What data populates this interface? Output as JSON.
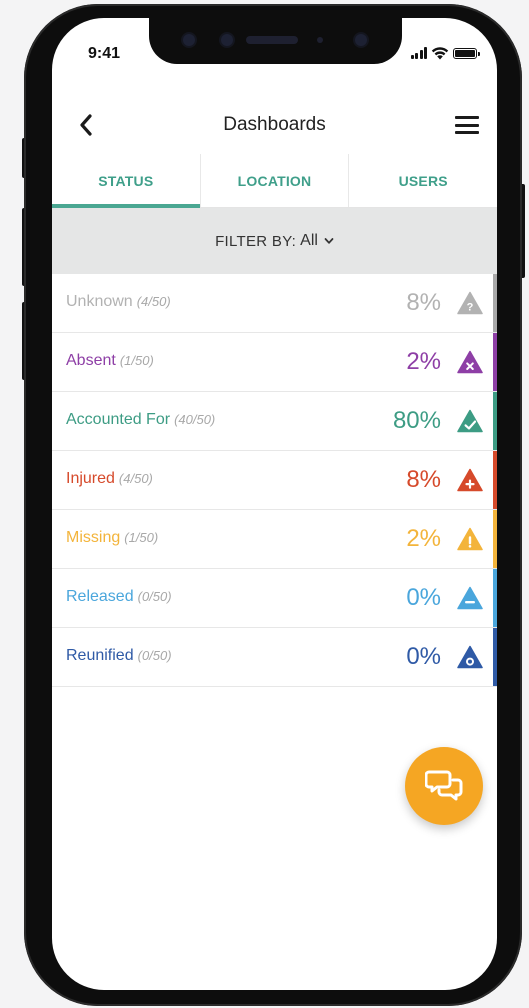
{
  "status_bar": {
    "time": "9:41"
  },
  "header": {
    "title": "Dashboards"
  },
  "tabs": [
    {
      "label": "STATUS",
      "active": true
    },
    {
      "label": "LOCATION",
      "active": false
    },
    {
      "label": "USERS",
      "active": false
    }
  ],
  "filter": {
    "prefix": "FILTER BY:",
    "value": "All"
  },
  "statuses": [
    {
      "label": "Unknown",
      "count": "(4/50)",
      "percent": "8%",
      "color": "#b2b2b2",
      "stripe": "#a9a9a9",
      "icon": "question-triangle-icon"
    },
    {
      "label": "Absent",
      "count": "(1/50)",
      "percent": "2%",
      "color": "#8e3fa6",
      "stripe": "#8e3fa6",
      "icon": "x-triangle-icon"
    },
    {
      "label": "Accounted For",
      "count": "(40/50)",
      "percent": "80%",
      "color": "#3d9c84",
      "stripe": "#3d9c84",
      "icon": "check-triangle-icon"
    },
    {
      "label": "Injured",
      "count": "(4/50)",
      "percent": "8%",
      "color": "#d64a2b",
      "stripe": "#d64a2b",
      "icon": "plus-triangle-icon"
    },
    {
      "label": "Missing",
      "count": "(1/50)",
      "percent": "2%",
      "color": "#f3b43b",
      "stripe": "#f3b43b",
      "icon": "exclamation-triangle-icon"
    },
    {
      "label": "Released",
      "count": "(0/50)",
      "percent": "0%",
      "color": "#4aa6dc",
      "stripe": "#4aa6dc",
      "icon": "minus-triangle-icon"
    },
    {
      "label": "Reunified",
      "count": "(0/50)",
      "percent": "0%",
      "color": "#2f5aa6",
      "stripe": "#2f5aa6",
      "icon": "circle-triangle-icon"
    }
  ],
  "fab": {
    "icon": "chat-bubbles-icon",
    "color": "#f5a623"
  }
}
